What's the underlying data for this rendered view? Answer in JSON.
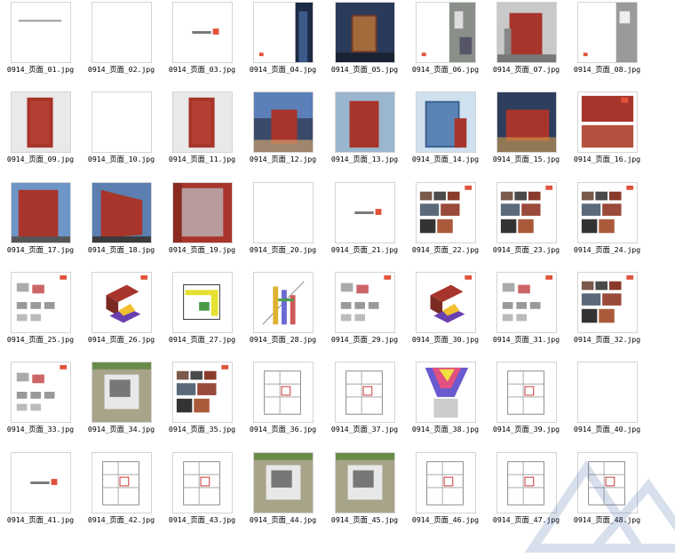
{
  "files": [
    {
      "name": "0914_页面_01.jpg",
      "icon": "text-page-thumbnail"
    },
    {
      "name": "0914_页面_02.jpg",
      "icon": "blank-page-thumbnail"
    },
    {
      "name": "0914_页面_03.jpg",
      "icon": "title-page-thumbnail"
    },
    {
      "name": "0914_页面_04.jpg",
      "icon": "night-tower-thumbnail"
    },
    {
      "name": "0914_页面_05.jpg",
      "icon": "night-building-thumbnail"
    },
    {
      "name": "0914_页面_06.jpg",
      "icon": "aerial-thumbnail"
    },
    {
      "name": "0914_页面_07.jpg",
      "icon": "brick-building-thumbnail"
    },
    {
      "name": "0914_页面_08.jpg",
      "icon": "aerial-strip-thumbnail"
    },
    {
      "name": "0914_页面_09.jpg",
      "icon": "brick-tower-thumbnail"
    },
    {
      "name": "0914_页面_10.jpg",
      "icon": "blank-page-thumbnail"
    },
    {
      "name": "0914_页面_11.jpg",
      "icon": "brick-tower-thumbnail"
    },
    {
      "name": "0914_页面_12.jpg",
      "icon": "dusk-building-thumbnail"
    },
    {
      "name": "0914_页面_13.jpg",
      "icon": "brick-tower-sky-thumbnail"
    },
    {
      "name": "0914_页面_14.jpg",
      "icon": "glass-tower-thumbnail"
    },
    {
      "name": "0914_页面_15.jpg",
      "icon": "dusk-facade-thumbnail"
    },
    {
      "name": "0914_页面_16.jpg",
      "icon": "facade-collage-thumbnail"
    },
    {
      "name": "0914_页面_17.jpg",
      "icon": "brick-facade-thumbnail"
    },
    {
      "name": "0914_页面_18.jpg",
      "icon": "perspective-facade-thumbnail"
    },
    {
      "name": "0914_页面_19.jpg",
      "icon": "brick-grid-thumbnail"
    },
    {
      "name": "0914_页面_20.jpg",
      "icon": "blank-page-thumbnail"
    },
    {
      "name": "0914_页面_21.jpg",
      "icon": "title-page-thumbnail"
    },
    {
      "name": "0914_页面_22.jpg",
      "icon": "photo-collage-thumbnail"
    },
    {
      "name": "0914_页面_23.jpg",
      "icon": "photo-collage-thumbnail"
    },
    {
      "name": "0914_页面_24.jpg",
      "icon": "photo-collage-thumbnail"
    },
    {
      "name": "0914_页面_25.jpg",
      "icon": "diagram-thumbnail"
    },
    {
      "name": "0914_页面_26.jpg",
      "icon": "massing-diagram-thumbnail"
    },
    {
      "name": "0914_页面_27.jpg",
      "icon": "plan-diagram-thumbnail"
    },
    {
      "name": "0914_页面_28.jpg",
      "icon": "section-diagram-thumbnail"
    },
    {
      "name": "0914_页面_29.jpg",
      "icon": "diagram-thumbnail"
    },
    {
      "name": "0914_页面_30.jpg",
      "icon": "massing-diagram-thumbnail"
    },
    {
      "name": "0914_页面_31.jpg",
      "icon": "diagram-thumbnail"
    },
    {
      "name": "0914_页面_32.jpg",
      "icon": "photo-collage-thumbnail"
    },
    {
      "name": "0914_页面_33.jpg",
      "icon": "diagram-thumbnail"
    },
    {
      "name": "0914_页面_34.jpg",
      "icon": "site-plan-thumbnail"
    },
    {
      "name": "0914_页面_35.jpg",
      "icon": "photo-collage-thumbnail"
    },
    {
      "name": "0914_页面_36.jpg",
      "icon": "floor-plan-thumbnail"
    },
    {
      "name": "0914_页面_37.jpg",
      "icon": "floor-plan-thumbnail"
    },
    {
      "name": "0914_页面_38.jpg",
      "icon": "analysis-map-thumbnail"
    },
    {
      "name": "0914_页面_39.jpg",
      "icon": "floor-plan-thumbnail"
    },
    {
      "name": "0914_页面_40.jpg",
      "icon": "blank-page-thumbnail"
    },
    {
      "name": "0914_页面_41.jpg",
      "icon": "title-page-thumbnail"
    },
    {
      "name": "0914_页面_42.jpg",
      "icon": "floor-plan-thumbnail"
    },
    {
      "name": "0914_页面_43.jpg",
      "icon": "floor-plan-thumbnail"
    },
    {
      "name": "0914_页面_44.jpg",
      "icon": "site-plan-thumbnail"
    },
    {
      "name": "0914_页面_45.jpg",
      "icon": "site-plan-thumbnail"
    },
    {
      "name": "0914_页面_46.jpg",
      "icon": "floor-plan-thumbnail"
    },
    {
      "name": "0914_页面_47.jpg",
      "icon": "floor-plan-thumbnail"
    },
    {
      "name": "0914_页面_48.jpg",
      "icon": "floor-plan-thumbnail"
    }
  ],
  "colors": {
    "brick": "#a8352b",
    "night": "#1d2a44",
    "sky": "#9bb6cf",
    "border": "#d4d4d4",
    "accent_red": "#e0533a"
  }
}
